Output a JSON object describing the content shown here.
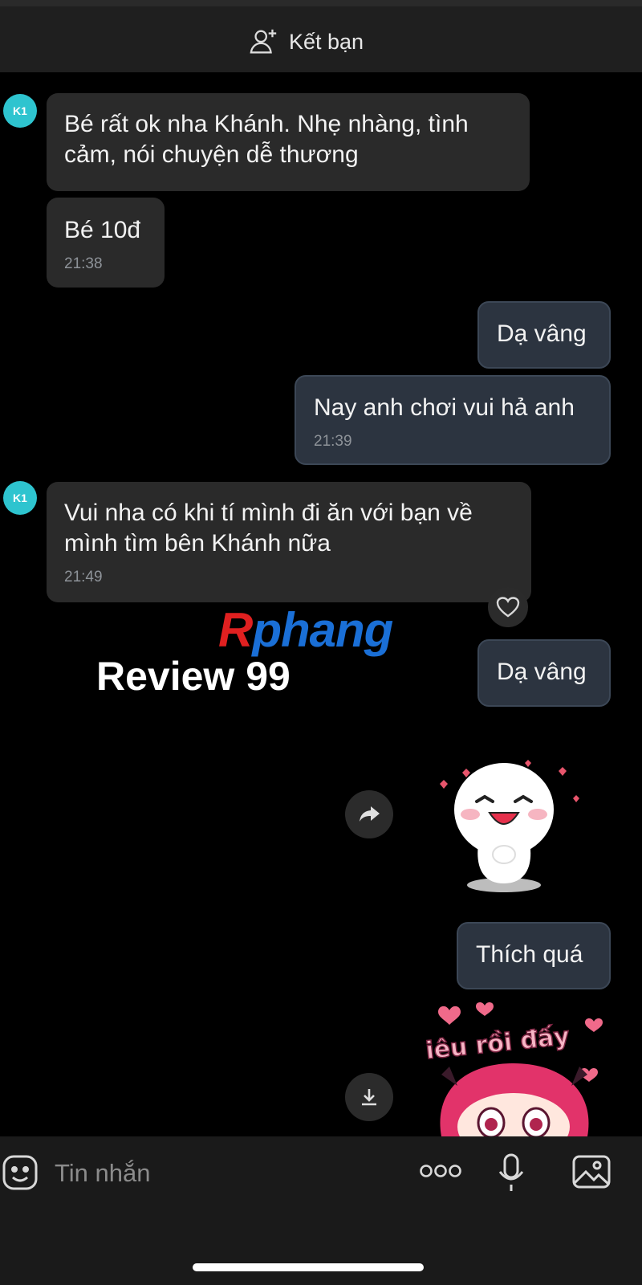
{
  "header": {
    "add_friend_label": "Kết bạn",
    "add_friend_icon": "person-plus-icon"
  },
  "contact": {
    "avatar_text": "K1"
  },
  "messages": [
    {
      "side": "received",
      "text_line1": "Bé rất ok nha Khánh. Nhẹ nhàng, tình",
      "text_line2": "cảm, nói chuyện dễ thương"
    },
    {
      "side": "received",
      "text": "Bé 10đ",
      "time": "21:38"
    },
    {
      "side": "sent",
      "text": "Dạ vâng"
    },
    {
      "side": "sent",
      "text": "Nay anh chơi vui hả anh",
      "time": "21:39"
    },
    {
      "side": "received",
      "text_line1": "Vui nha có khi tí mình đi ăn với bạn về",
      "text_line2": "mình tìm bên Khánh nữa",
      "time": "21:49"
    },
    {
      "side": "sent",
      "text": "Dạ vâng"
    },
    {
      "side": "sent",
      "type": "sticker",
      "description": "white-blob-smiling-sticker"
    },
    {
      "side": "sent",
      "text": "Thích quá"
    },
    {
      "side": "sent",
      "type": "sticker",
      "sticker_text": "iêu rồi đấy"
    }
  ],
  "watermark": {
    "logo_r": "R",
    "logo_rest": "phang",
    "caption": "Review 99"
  },
  "composer": {
    "placeholder": "Tin nhắn"
  },
  "colors": {
    "received_bubble": "#2a2a2a",
    "sent_bubble": "#2c3440",
    "avatar": "#2ec4cf",
    "background": "#000000"
  }
}
